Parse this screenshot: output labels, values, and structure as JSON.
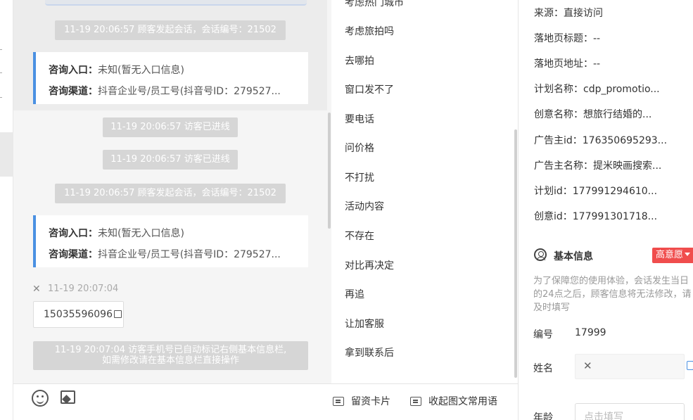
{
  "chat": {
    "sys1": "11-19 20:06:57 顾客发起会话，会话编号：21502",
    "card1": {
      "entry_label": "咨询入口：",
      "entry_value": "未知(暂无入口信息)",
      "channel_label": "咨询渠道：",
      "channel_value": "抖音企业号/员工号(抖音号ID：279527..."
    },
    "sys2": "11-19 20:06:57 访客已进线",
    "sys3": "11-19 20:06:57 访客已进线",
    "sys4": "11-19 20:06:57 顾客发起会话，会话编号：21502",
    "card2": {
      "entry_label": "咨询入口：",
      "entry_value": "未知(暂无入口信息)",
      "channel_label": "咨询渠道：",
      "channel_value": "抖音企业号/员工号(抖音号ID：279527..."
    },
    "visitor_close": "✕",
    "visitor_time": "11-19 20:07:04",
    "phone": "15035596096",
    "notice_line1": "11-19 20:07:04 访客手机号已自动标记右侧基本信息栏,",
    "notice_line2": "如需修改请在基本信息栏直接操作"
  },
  "phrases": [
    "考虑热门城市",
    "考虑旅拍吗",
    "去哪拍",
    "窗口发不了",
    "要电话",
    "问价格",
    "不打扰",
    "活动内容",
    "不存在",
    "对比再决定",
    "再追",
    "让加客服",
    "拿到联系后"
  ],
  "phrase_bar": {
    "save_card": "留资卡片",
    "collapse": "收起图文常用语"
  },
  "source": {
    "from": "来源：直接访问",
    "landing_title": "落地页标题：--",
    "landing_url": "落地页地址：--",
    "plan_name": "计划名称：cdp_promotio...",
    "creative_name": "创意名称：想旅行结婚的...",
    "advertiser_id": "广告主id：176350695293...",
    "advertiser_name": "广告主名称：提米映画搜索...",
    "plan_id": "计划id：177991294610...",
    "creative_id": "创意id：177991301718..."
  },
  "basic": {
    "title": "基本信息",
    "intent": "高意愿",
    "hint": "为了保障您的使用体验，会话发生当日的24点之后，顾客信息将无法修改，请及时填写",
    "num_label": "编号",
    "num_value": "17999",
    "name_label": "姓名",
    "age_label": "年龄",
    "age_placeholder": "点击填写"
  },
  "colors": {
    "accent": "#4a90e2",
    "intent": "#f04d4d",
    "system_msg": "#d6d6d6"
  }
}
